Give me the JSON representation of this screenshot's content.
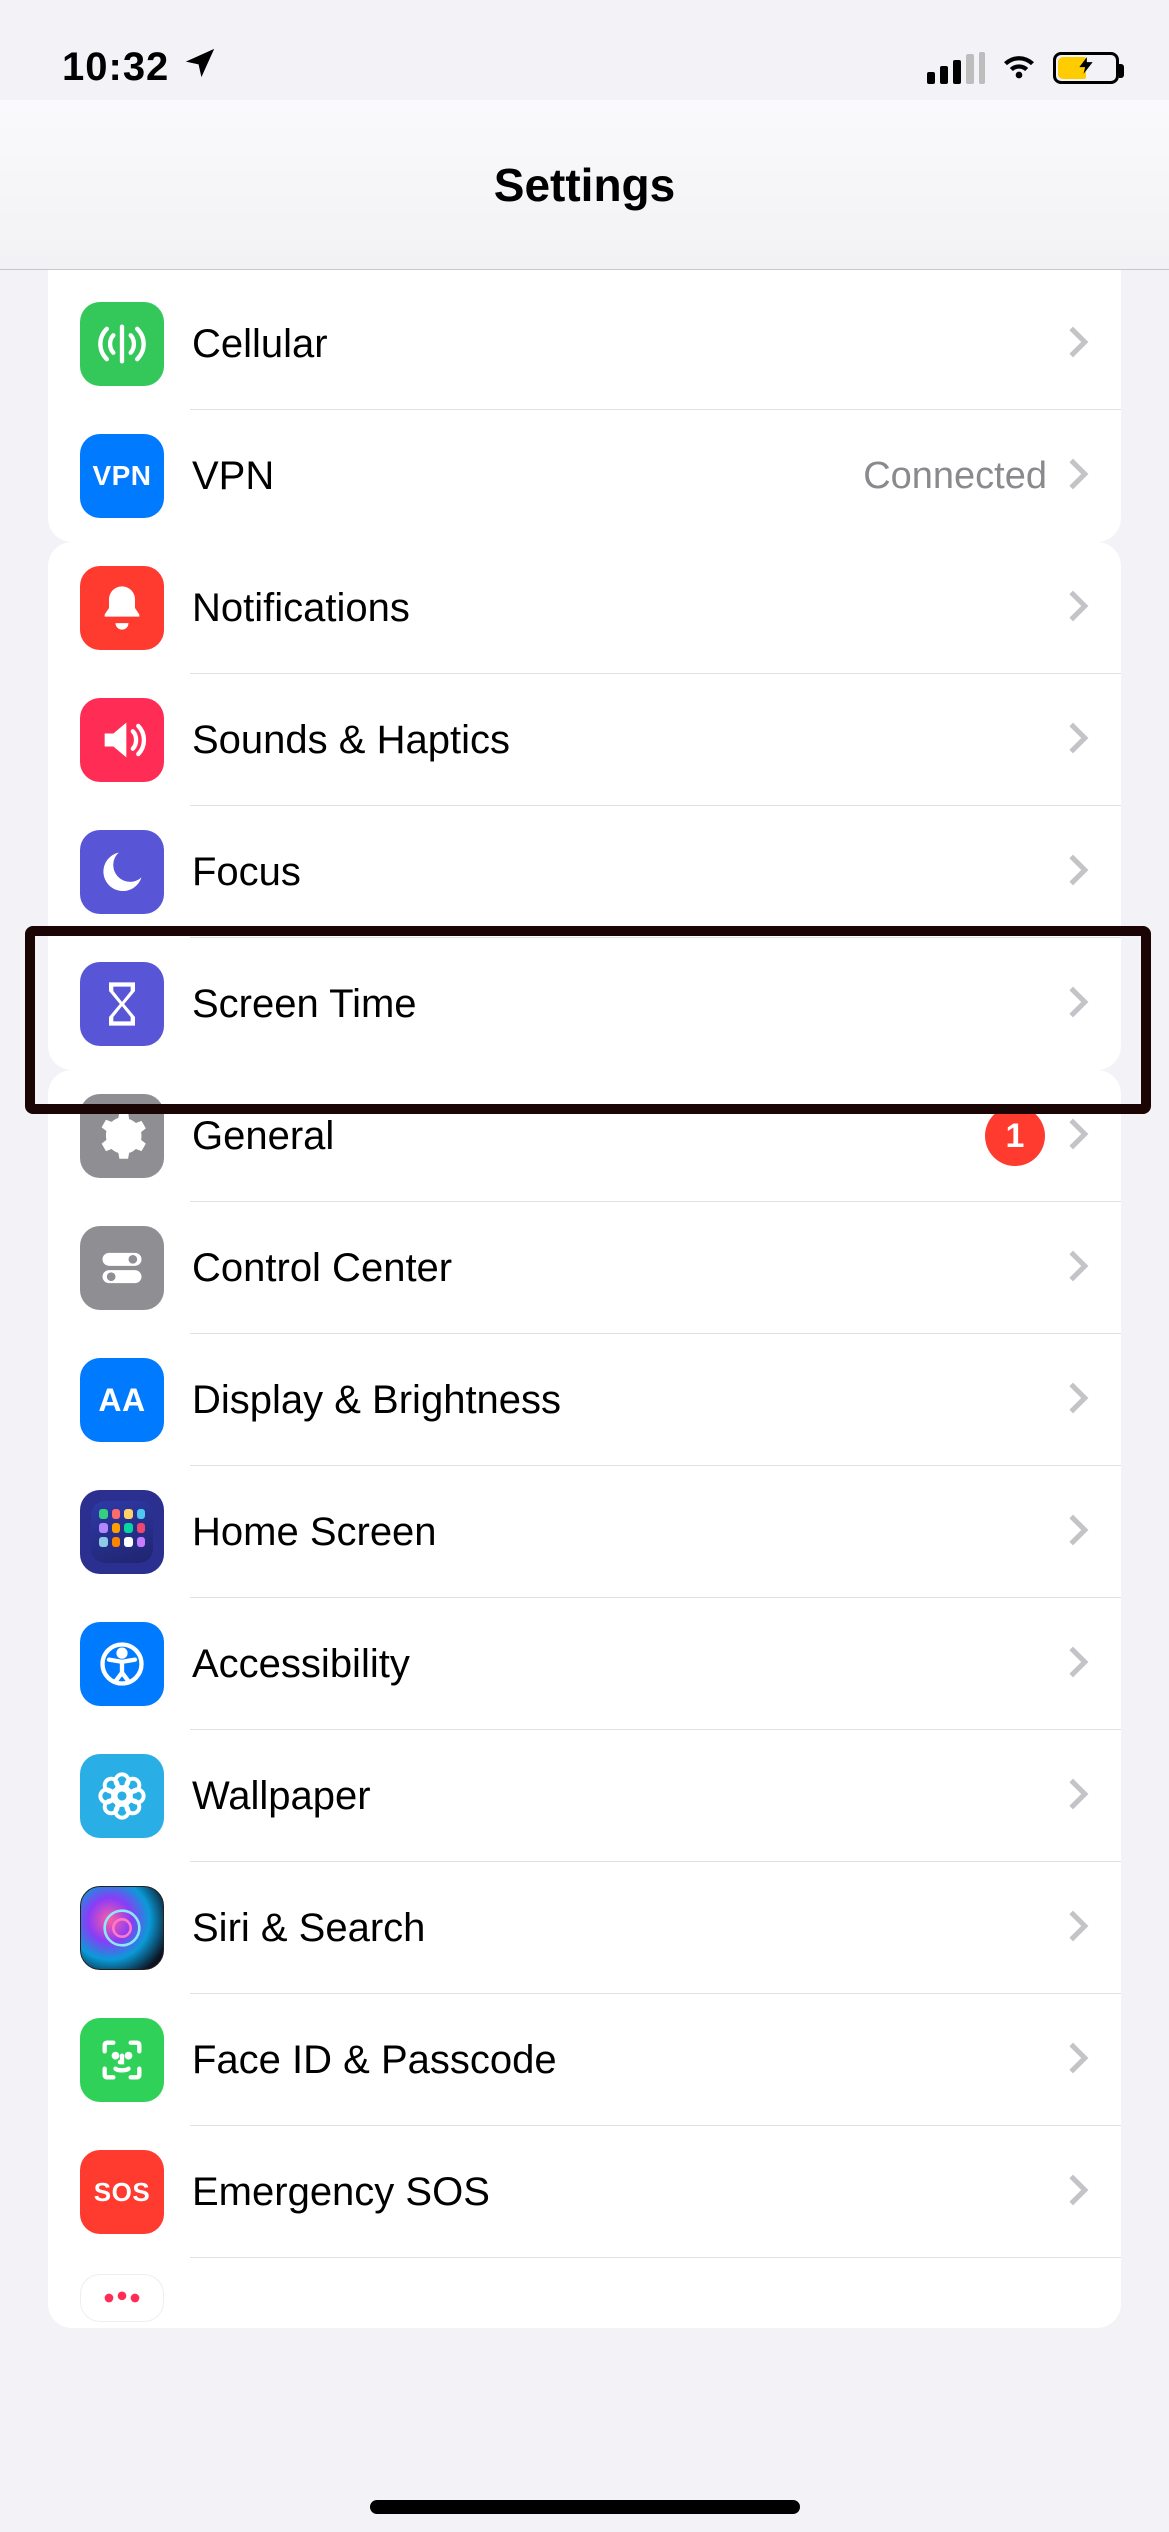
{
  "status": {
    "time": "10:32"
  },
  "header": {
    "title": "Settings"
  },
  "groups": [
    {
      "rows": [
        {
          "label": "Cellular",
          "value": ""
        },
        {
          "label": "VPN",
          "value": "Connected",
          "iconText": "VPN"
        }
      ]
    },
    {
      "rows": [
        {
          "label": "Notifications"
        },
        {
          "label": "Sounds & Haptics"
        },
        {
          "label": "Focus"
        },
        {
          "label": "Screen Time",
          "highlighted": true
        }
      ]
    },
    {
      "rows": [
        {
          "label": "General",
          "badge": "1"
        },
        {
          "label": "Control Center"
        },
        {
          "label": "Display & Brightness",
          "iconText": "AA"
        },
        {
          "label": "Home Screen"
        },
        {
          "label": "Accessibility"
        },
        {
          "label": "Wallpaper"
        },
        {
          "label": "Siri & Search"
        },
        {
          "label": "Face ID & Passcode"
        },
        {
          "label": "Emergency SOS",
          "iconText": "SOS"
        },
        {
          "label": ""
        }
      ]
    }
  ]
}
